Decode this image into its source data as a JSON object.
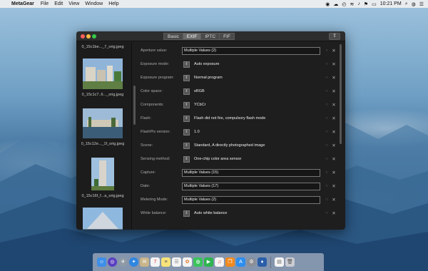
{
  "menubar": {
    "app": "MetaGear",
    "menus": [
      "File",
      "Edit",
      "View",
      "Window",
      "Help"
    ],
    "time": "10:21 PM"
  },
  "window": {
    "tabs": [
      "Basic",
      "EXIF",
      "IPTC",
      "FIF"
    ],
    "active_tab": "EXIF",
    "sidebar_items": [
      "0_15c1be..._7_orig.jpeg",
      "0_15c1c7..6..._orig.jpeg",
      "0_15c12e..._1f_orig.jpeg",
      "0_15c16f_f...a_orig.jpeg"
    ],
    "fields": [
      {
        "label": "Aperture value:",
        "value": "Multiple Values (2)"
      },
      {
        "label": "Exposure mode:",
        "value": "Auto exposure"
      },
      {
        "label": "Exposure program:",
        "value": "Normal program"
      },
      {
        "label": "Color space:",
        "value": "sRGB"
      },
      {
        "label": "Components:",
        "value": "YCbCr"
      },
      {
        "label": "Flash:",
        "value": "Flash did not fire, compulsory flash mode"
      },
      {
        "label": "FlashPix version:",
        "value": "1.0"
      },
      {
        "label": "Scene:",
        "value": "Standard, A directly photographed image"
      },
      {
        "label": "Sensing method:",
        "value": "One-chip color area sensor"
      },
      {
        "label": "Capture:",
        "value": "Multiple Values (15)"
      },
      {
        "label": "Date:",
        "value": "Multiple Values (17)"
      },
      {
        "label": "Metering Mode:",
        "value": "Multiple Values (2)"
      },
      {
        "label": "White balance:",
        "value": "Auto white balance"
      }
    ]
  },
  "colors": {
    "window_bg": "#1e1e1e",
    "close": "#fc605b",
    "minimize": "#fdbc40",
    "maximize": "#34c84a"
  },
  "dock": {
    "icons": [
      "finder-icon",
      "siri-icon",
      "launchpad-icon",
      "safari-icon",
      "mail-icon",
      "calendar-icon",
      "notes-icon",
      "reminders-icon",
      "photos-icon",
      "messages-icon",
      "facetime-icon",
      "music-icon",
      "books-icon",
      "app-store-icon",
      "system-preferences-icon",
      "metagear-icon",
      "document-icon",
      "trash-icon"
    ]
  }
}
